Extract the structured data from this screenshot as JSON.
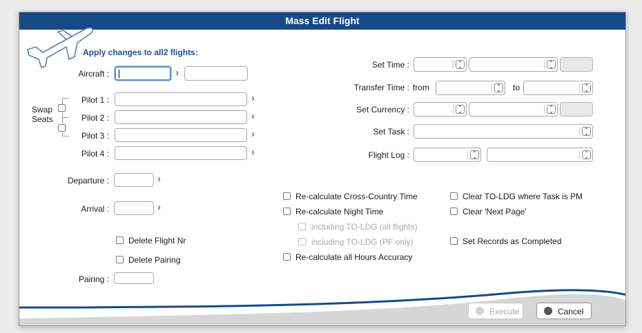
{
  "window": {
    "title": "Mass Edit Flight"
  },
  "header": {
    "apply_text": "Apply changes to all2 flights:"
  },
  "left": {
    "aircraft_label": "Aircraft :",
    "swap_seats_label_1": "Swap",
    "swap_seats_label_2": "Seats",
    "pilot1_label": "Pilot 1 :",
    "pilot2_label": "Pilot 2 :",
    "pilot3_label": "Pilot 3 :",
    "pilot4_label": "Pilot 4 :",
    "departure_label": "Departure :",
    "arrival_label": "Arrival :",
    "delete_flight_nr": "Delete Flight Nr",
    "delete_pairing": "Delete Pairing",
    "pairing_label": "Pairing :"
  },
  "right": {
    "set_time_label": "Set Time :",
    "transfer_time_label": "Transfer Time :",
    "from_label": "from",
    "to_label": "to",
    "set_currency_label": "Set Currency :",
    "set_task_label": "Set Task :",
    "flight_log_label": "Flight Log :"
  },
  "options": {
    "recalc_cross_country": "Re-calculate Cross-Country Time",
    "recalc_night": "Re-calculate Night Time",
    "incl_to_ldg_all": "including TO-LDG (all flights)",
    "incl_to_ldg_pf": "including TO-LDG (PF only)",
    "recalc_hours_accuracy": "Re-calculate all Hours Accuracy",
    "clear_to_ldg_pm": "Clear TO-LDG where Task is PM",
    "clear_next_page": "Clear 'Next Page'",
    "set_records_completed": "Set Records as Completed"
  },
  "buttons": {
    "execute": "Execute",
    "cancel": "Cancel"
  },
  "icons": {
    "chevron": "›",
    "stepper": "⌃⌄"
  },
  "colors": {
    "title_bar": "#164a87",
    "accent": "#4a7fc4",
    "header_text": "#1d4f8f"
  }
}
